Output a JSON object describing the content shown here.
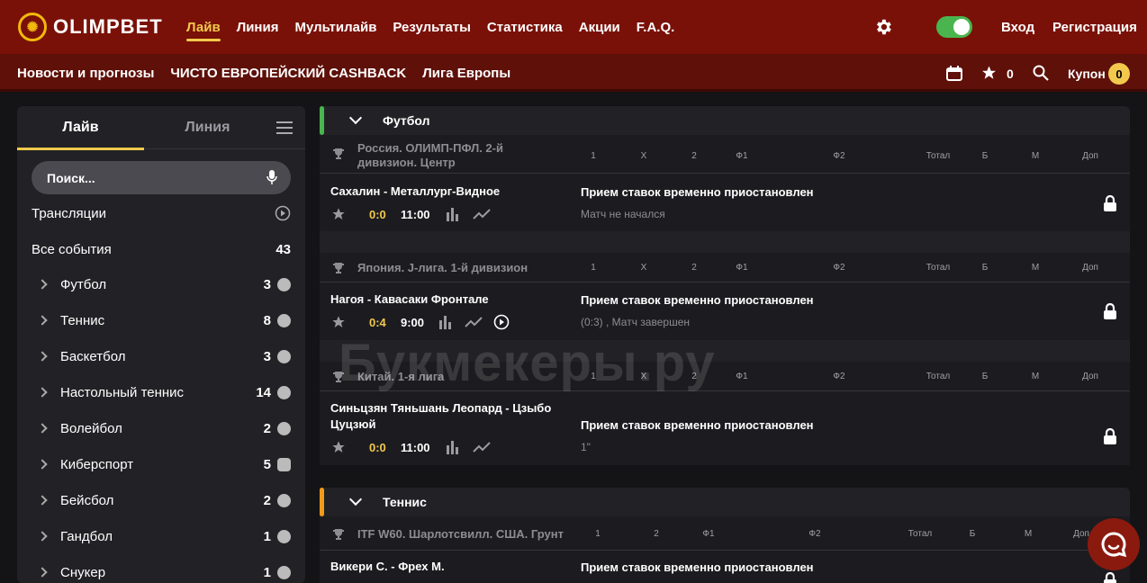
{
  "brand": {
    "logo_text": "OLIMPBET",
    "colors": {
      "header": "#7a1108",
      "subheader": "#5e1009",
      "accent": "#f2c94c",
      "toggle": "#4ab54e"
    }
  },
  "nav": {
    "items": [
      "Лайв",
      "Линия",
      "Мультилайв",
      "Результаты",
      "Статистика",
      "Акции",
      "F.A.Q."
    ],
    "active": "Лайв"
  },
  "header_right": {
    "login": "Вход",
    "register": "Регистрация",
    "icons": [
      "gear-icon",
      "moon-icon",
      "theme-toggle"
    ]
  },
  "subnav": {
    "items": [
      "Новости и прогнозы",
      "ЧИСТО ЕВРОПЕЙСКИЙ CASHBACK",
      "Лига Европы"
    ],
    "favorites_count": "0",
    "coupon_label": "Купон",
    "coupon_count": "0"
  },
  "sidebar": {
    "tab_live": "Лайв",
    "tab_line": "Линия",
    "search_placeholder": "Поиск...",
    "broadcasts": "Трансляции",
    "all_events": "Все события",
    "all_count": "43",
    "sports": [
      {
        "name": "Футбол",
        "count": "3",
        "icon": "football-icon"
      },
      {
        "name": "Теннис",
        "count": "8",
        "icon": "tennis-icon"
      },
      {
        "name": "Баскетбол",
        "count": "3",
        "icon": "basketball-icon"
      },
      {
        "name": "Настольный теннис",
        "count": "14",
        "icon": "table-tennis-icon"
      },
      {
        "name": "Волейбол",
        "count": "2",
        "icon": "volleyball-icon"
      },
      {
        "name": "Киберспорт",
        "count": "5",
        "icon": "gamepad-icon"
      },
      {
        "name": "Бейсбол",
        "count": "2",
        "icon": "baseball-icon"
      },
      {
        "name": "Гандбол",
        "count": "1",
        "icon": "handball-icon"
      },
      {
        "name": "Снукер",
        "count": "1",
        "icon": "snooker-icon"
      }
    ]
  },
  "columns": [
    "1",
    "X",
    "2",
    "Ф1",
    "Ф2",
    "Тотал",
    "Б",
    "М",
    "Доп"
  ],
  "tennis_columns": [
    "1",
    "2",
    "Ф1",
    "Ф2",
    "Тотал",
    "Б",
    "М",
    "Доп"
  ],
  "football": {
    "title": "Футбол",
    "color": "#4ab54e",
    "leagues": [
      {
        "name": "Россия. ОЛИМП-ПФЛ. 2-й дивизион. Центр",
        "event": {
          "teams": "Сахалин - Металлург-Видное",
          "score": "0:0",
          "time": "11:00",
          "status": "Прием ставок временно приостановлен",
          "sub": "Матч не начался"
        }
      },
      {
        "name": "Япония. J-лига. 1-й дивизион",
        "event": {
          "teams": "Нагоя - Кавасаки Фронтале",
          "score": "0:4",
          "time": "9:00",
          "status": "Прием ставок временно приостановлен",
          "sub": "(0:3) , Матч завершен"
        }
      },
      {
        "name": "Китай. 1-я лига",
        "event": {
          "teams": "Синьцзян Тяньшань Леопард - Цзыбо Цуцзюй",
          "score": "0:0",
          "time": "11:00",
          "status": "Прием ставок временно приостановлен",
          "sub": "1\""
        }
      }
    ]
  },
  "tennis": {
    "title": "Теннис",
    "color": "#f29a1a",
    "leagues": [
      {
        "name": "ITF W60. Шарлотсвилл. США. Грунт",
        "event": {
          "teams": "Викери С. - Фрех М.",
          "status": "Прием ставок временно приостановлен"
        }
      }
    ]
  },
  "watermark": "Букмекеры.ру"
}
